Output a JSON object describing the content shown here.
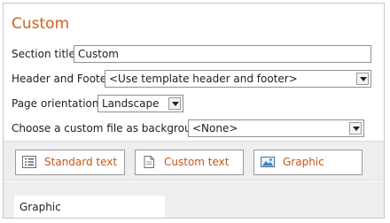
{
  "title": "Custom",
  "section_title": {
    "label": "Section title:",
    "value": "Custom"
  },
  "header_footer": {
    "label": "Header and Footer:",
    "value": "<Use template header and footer>"
  },
  "orientation": {
    "label": "Page orientation:",
    "value": "Landscape"
  },
  "background_file": {
    "label": "Choose a custom file as background:",
    "value": "<None>"
  },
  "content_types": [
    {
      "label": "Standard text",
      "icon": "list-icon"
    },
    {
      "label": "Custom text",
      "icon": "document-icon"
    },
    {
      "label": "Graphic",
      "icon": "picture-icon"
    }
  ],
  "preview": {
    "label": "Graphic"
  },
  "colors": {
    "accent": "#d0611b",
    "button_text": "#c3561a"
  }
}
